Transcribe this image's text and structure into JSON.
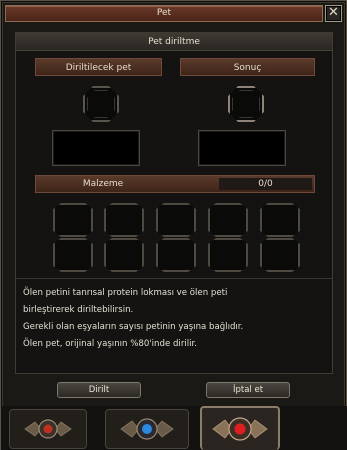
{
  "window": {
    "title": "Pet",
    "close_icon_glyph": "✕"
  },
  "panel": {
    "header": "Pet diriltme",
    "revive_pet_label": "Diriltilecek pet",
    "result_label": "Sonuç",
    "material_label": "Malzeme",
    "material_count": "0/0",
    "info_lines": [
      "Ölen petini tanrısal protein lokması ve ölen peti",
      "birleştirerek diriltebilirsin.",
      "Gerekli olan eşyaların sayısı petinin yaşına bağlıdır.",
      "Ölen pet, orijinal yaşının %80'inde dirilir."
    ]
  },
  "buttons": {
    "revive": "Dirilt",
    "cancel": "İptal et"
  },
  "tabs": [
    {
      "name": "tab-1",
      "icon": "red-gem-emblem-icon",
      "active": false,
      "gem_color": "#c03020"
    },
    {
      "name": "tab-2",
      "icon": "blue-gem-emblem-icon",
      "active": false,
      "gem_color": "#2a8ae0"
    },
    {
      "name": "tab-3",
      "icon": "red-gem-emblem-icon",
      "active": true,
      "gem_color": "#e02020"
    }
  ],
  "colors": {
    "accent_brown": "#5a3a2a",
    "title_bar": "#4a2418"
  }
}
